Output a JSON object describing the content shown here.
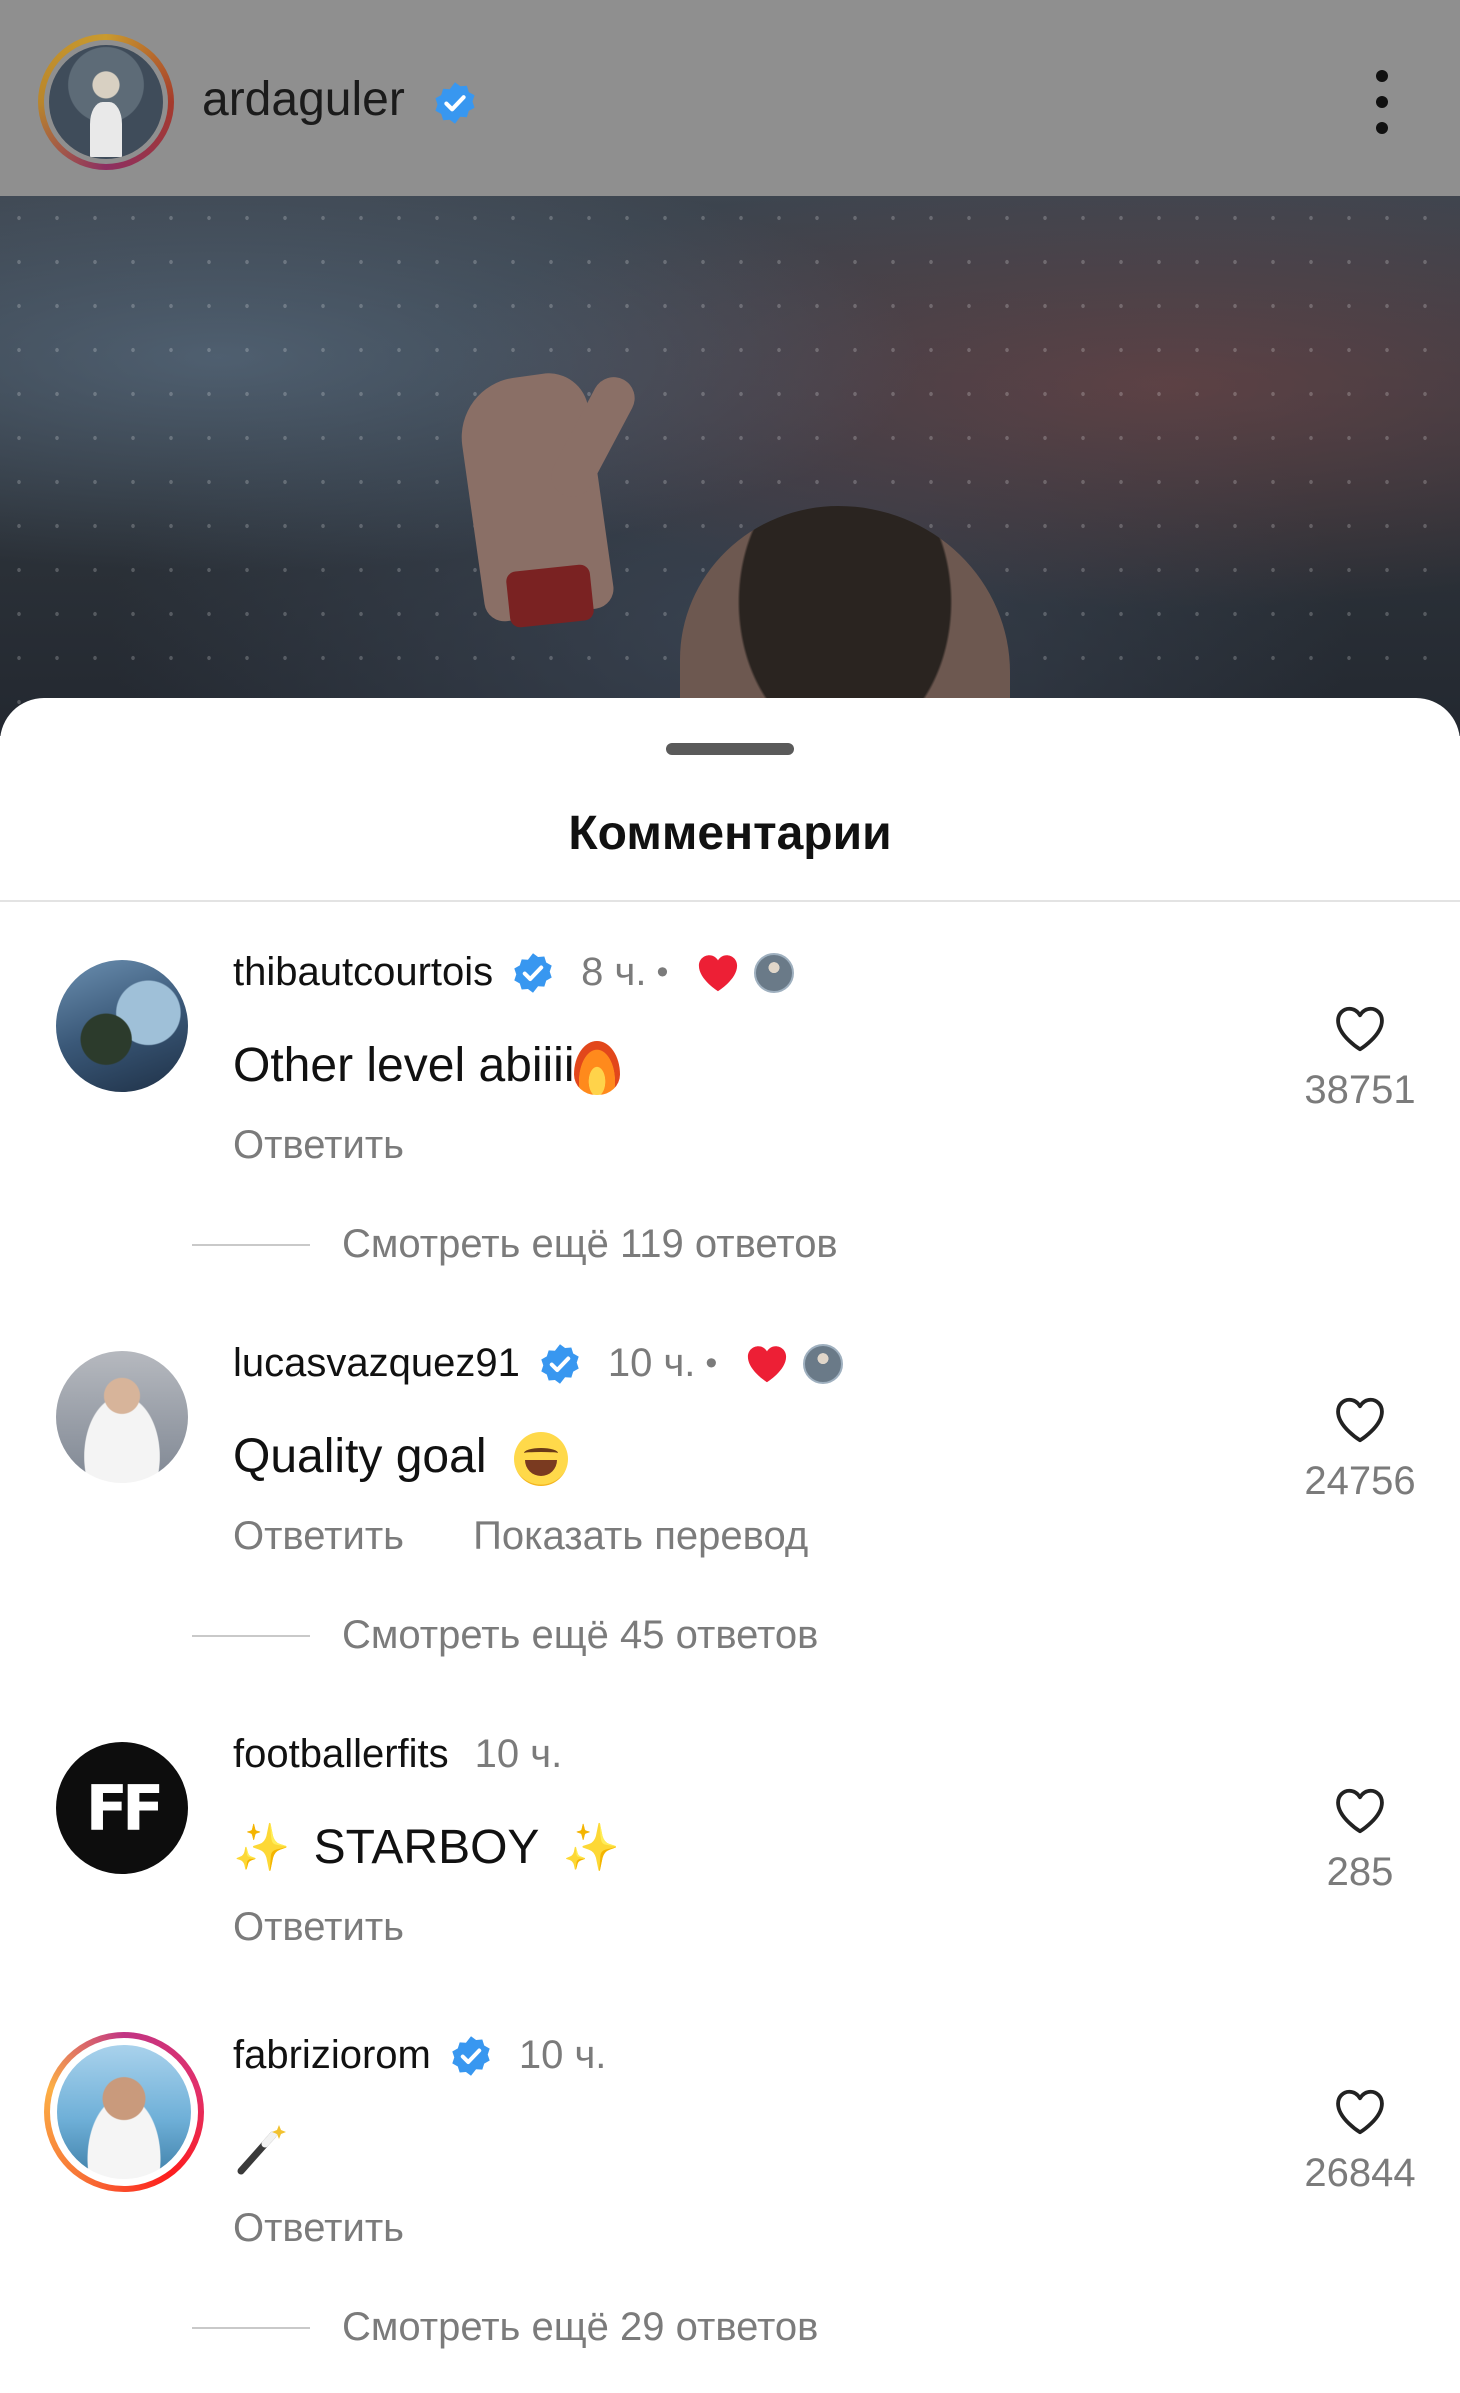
{
  "header": {
    "username": "ardaguler",
    "verified": true,
    "more_icon": "more-vertical-icon"
  },
  "sheet": {
    "title": "Комментарии"
  },
  "colors": {
    "verified_blue": "#3897f0",
    "like_red": "#ed1f35",
    "muted_text": "#7b7b7b"
  },
  "comments": [
    {
      "username": "thibautcourtois",
      "verified": true,
      "time": "8 ч.",
      "liked_by_author": true,
      "text": "Other level abiiii",
      "emoji": "fire",
      "reply_label": "Ответить",
      "likes": "38751",
      "view_replies": "Смотреть ещё 119 ответов"
    },
    {
      "username": "lucasvazquez91",
      "verified": true,
      "time": "10 ч.",
      "liked_by_author": true,
      "text": "Quality goal",
      "emoji": "grinning-squinting-face",
      "reply_label": "Ответить",
      "translate_label": "Показать перевод",
      "likes": "24756",
      "view_replies": "Смотреть ещё 45 ответов"
    },
    {
      "username": "footballerfits",
      "verified": false,
      "time": "10 ч.",
      "avatar_text": "FF",
      "text": "STARBOY",
      "emoji": "sparkles",
      "reply_label": "Ответить",
      "likes": "285"
    },
    {
      "username": "fabriziorom",
      "verified": true,
      "time": "10 ч.",
      "text": "",
      "emoji": "magic-wand",
      "reply_label": "Ответить",
      "likes": "26844",
      "view_replies": "Смотреть ещё 29 ответов"
    }
  ]
}
